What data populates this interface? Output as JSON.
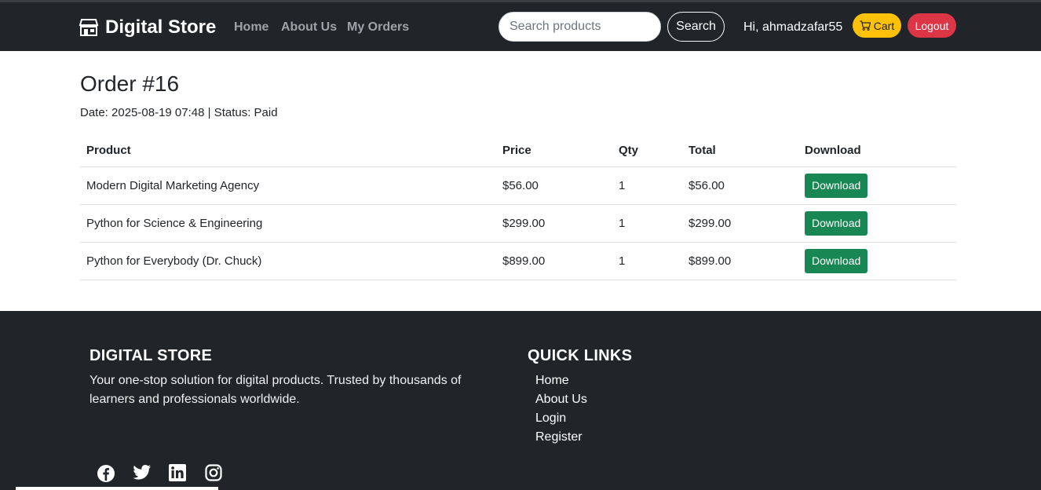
{
  "nav": {
    "brand": "Digital Store",
    "links": [
      "Home",
      "About Us",
      "My Orders"
    ],
    "search_placeholder": "Search products",
    "search_label": "Search",
    "greeting": "Hi, ahmadzafar55",
    "cart_label": "Cart",
    "logout_label": "Logout"
  },
  "order": {
    "title": "Order #16",
    "meta": "Date: 2025-08-19 07:48 | Status: Paid",
    "columns": [
      "Product",
      "Price",
      "Qty",
      "Total",
      "Download"
    ],
    "rows": [
      {
        "product": "Modern Digital Marketing Agency",
        "price": "$56.00",
        "qty": "1",
        "total": "$56.00",
        "download": "Download"
      },
      {
        "product": "Python for Science & Engineering",
        "price": "$299.00",
        "qty": "1",
        "total": "$299.00",
        "download": "Download"
      },
      {
        "product": "Python for Everybody (Dr. Chuck)",
        "price": "$899.00",
        "qty": "1",
        "total": "$899.00",
        "download": "Download"
      }
    ]
  },
  "footer": {
    "heading": "DIGITAL STORE",
    "description": "Your one-stop solution for digital products. Trusted by thousands of learners and professionals worldwide.",
    "quick_links_heading": "QUICK LINKS",
    "quick_links": [
      "Home",
      "About Us",
      "Login",
      "Register"
    ],
    "socials": [
      "facebook-icon",
      "twitter-icon",
      "linkedin-icon",
      "instagram-icon"
    ]
  },
  "colors": {
    "navbar": "#212529",
    "cart": "#ffc107",
    "logout": "#dc3545",
    "download": "#198754"
  }
}
